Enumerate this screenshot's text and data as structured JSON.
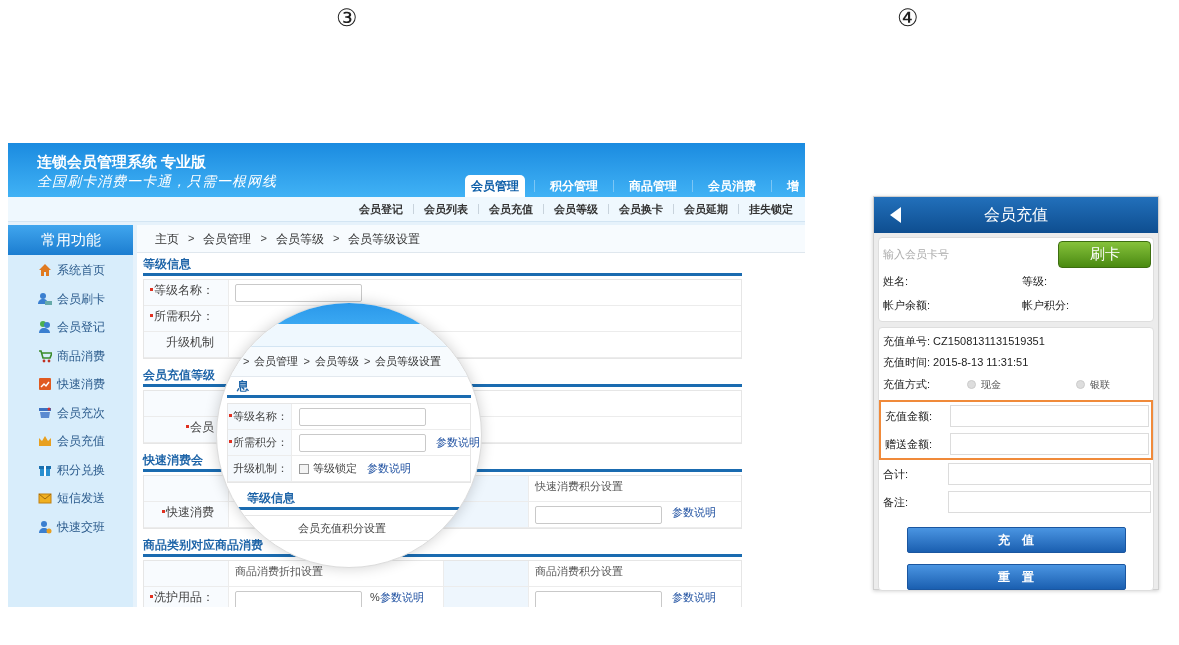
{
  "markers": [
    "③",
    "④"
  ],
  "desktop": {
    "title": "连锁会员管理系统 专业版",
    "slogan": "全国刷卡消费一卡通，只需一根网线",
    "tabs": [
      {
        "label": "会员管理",
        "selected": true
      },
      {
        "label": "积分管理",
        "selected": false
      },
      {
        "label": "商品管理",
        "selected": false
      },
      {
        "label": "会员消费",
        "selected": false
      },
      {
        "label": "增",
        "selected": false
      }
    ],
    "subnav": [
      "会员登记",
      "会员列表",
      "会员充值",
      "会员等级",
      "会员换卡",
      "会员延期",
      "挂失锁定"
    ],
    "sidebar": {
      "title": "常用功能",
      "items": [
        "系统首页",
        "会员刷卡",
        "会员登记",
        "商品消费",
        "快速消费",
        "会员充次",
        "会员充值",
        "积分兑换",
        "短信发送",
        "快速交班"
      ]
    },
    "breadcrumb_separator": ">",
    "breadcrumb": [
      "主页",
      "会员管理",
      "会员等级",
      "会员等级设置"
    ],
    "sections": [
      {
        "heading": "等级信息",
        "kind": "single",
        "rows": [
          {
            "label": "等级名称：",
            "required": true,
            "main": [
              {
                "kind": "input"
              }
            ]
          },
          {
            "label": "所需积分：",
            "required": true
          },
          {
            "label": "升级机制",
            "required": false
          }
        ]
      },
      {
        "heading": "会员充值等级",
        "kind": "single",
        "rows": [
          {},
          {
            "label": "会员",
            "required": true
          }
        ]
      },
      {
        "heading": "快速消费会",
        "kind": "split",
        "rows": [
          {
            "side": [
              {
                "kind": "text",
                "text": "快速消费积分设置"
              }
            ]
          },
          {
            "label": "快速消费",
            "required": true,
            "side": [
              {
                "kind": "input"
              },
              {
                "kind": "link",
                "text": "参数说明"
              }
            ]
          }
        ]
      },
      {
        "heading": "商品类别对应商品消费",
        "kind": "split",
        "rows": [
          {
            "main": [
              {
                "kind": "text",
                "text": "商品消费折扣设置"
              }
            ],
            "side": [
              {
                "kind": "text",
                "text": "商品消费积分设置"
              }
            ]
          },
          {
            "label": "洗护用品：",
            "required": true,
            "main": [
              {
                "kind": "input"
              },
              {
                "kind": "suffix",
                "text": "%"
              },
              {
                "kind": "link",
                "text": "参数说明"
              }
            ],
            "side": [
              {
                "kind": "input"
              },
              {
                "kind": "link",
                "text": "参数说明"
              }
            ]
          }
        ]
      }
    ]
  },
  "lens": {
    "breadcrumb": [
      "会员管理",
      "会员等级",
      "会员等级设置"
    ],
    "heading": "息",
    "rows": [
      {
        "label": "等级名称：",
        "required": true,
        "items": [
          {
            "kind": "input"
          }
        ]
      },
      {
        "label": "所需积分：",
        "required": true,
        "items": [
          {
            "kind": "input"
          },
          {
            "kind": "link",
            "text": "参数说明"
          }
        ]
      },
      {
        "label": "升级机制：",
        "required": false,
        "items": [
          {
            "kind": "checkbox",
            "text": "等级锁定",
            "checked": false
          },
          {
            "kind": "link",
            "text": "参数说明"
          }
        ]
      }
    ],
    "heading2": "等级信息",
    "row_text": "会员充值积分设置"
  },
  "mobile": {
    "title": "会员充值",
    "card_placeholder": "输入会员卡号",
    "swipe_button": "刷卡",
    "info": [
      "姓名:",
      "等级:",
      "帐户余额:",
      "帐户积分:"
    ],
    "order_no": "充值单号: CZ1508131131519351",
    "order_time": "充值时间: 2015-8-13 11:31:51",
    "payment": {
      "label": "充值方式:",
      "options": [
        {
          "label": "现金",
          "selected": false
        },
        {
          "label": "银联",
          "selected": false
        }
      ]
    },
    "fields": [
      {
        "label": "充值金额:",
        "highlighted": true
      },
      {
        "label": "赠送金额:",
        "highlighted": true
      },
      {
        "label": "合计:",
        "highlighted": false
      },
      {
        "label": "备注:",
        "highlighted": false
      }
    ],
    "buttons": [
      "充　值",
      "重　置"
    ]
  }
}
